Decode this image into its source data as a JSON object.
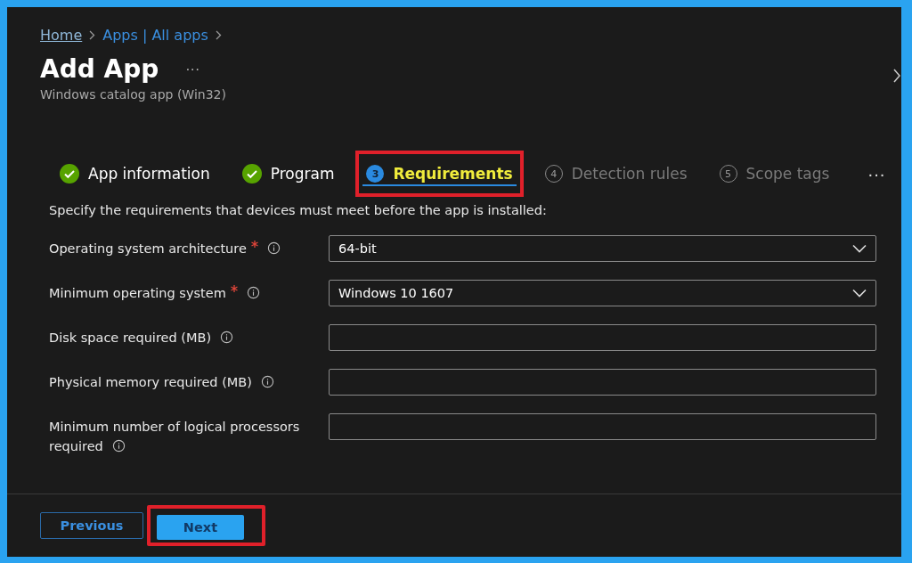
{
  "breadcrumb": [
    {
      "label": "Home"
    },
    {
      "label": "Apps | All apps"
    }
  ],
  "title": "Add App",
  "more": "···",
  "subtitle": "Windows catalog app (Win32)",
  "steps": [
    {
      "label": "App information",
      "completed": true,
      "selected": false,
      "highlighted": false
    },
    {
      "label": "Program",
      "completed": true,
      "selected": false,
      "highlighted": false
    },
    {
      "number": "3",
      "label": "Requirements",
      "completed": false,
      "selected": true,
      "highlighted": true
    },
    {
      "number": "4",
      "label": "Detection rules",
      "completed": false,
      "selected": false,
      "highlighted": false
    },
    {
      "number": "5",
      "label": "Scope tags",
      "completed": false,
      "selected": false,
      "highlighted": false
    }
  ],
  "steps_more": "···",
  "intro": "Specify the requirements that devices must meet before the app is installed:",
  "fields": [
    {
      "label": "Operating system architecture",
      "required": true,
      "kind": "select",
      "value": "64-bit"
    },
    {
      "label": "Minimum operating system",
      "required": true,
      "kind": "select",
      "value": "Windows 10 1607"
    },
    {
      "label": "Disk space required (MB)",
      "required": false,
      "kind": "text"
    },
    {
      "label": "Physical memory required (MB)",
      "required": false,
      "kind": "text"
    },
    {
      "label": "Minimum number of logical processors required",
      "required": false,
      "kind": "text"
    }
  ],
  "buttons": [
    {
      "label": "Previous",
      "kind": "secondary",
      "highlighted": false
    },
    {
      "label": "Next",
      "kind": "primary",
      "highlighted": true
    }
  ]
}
